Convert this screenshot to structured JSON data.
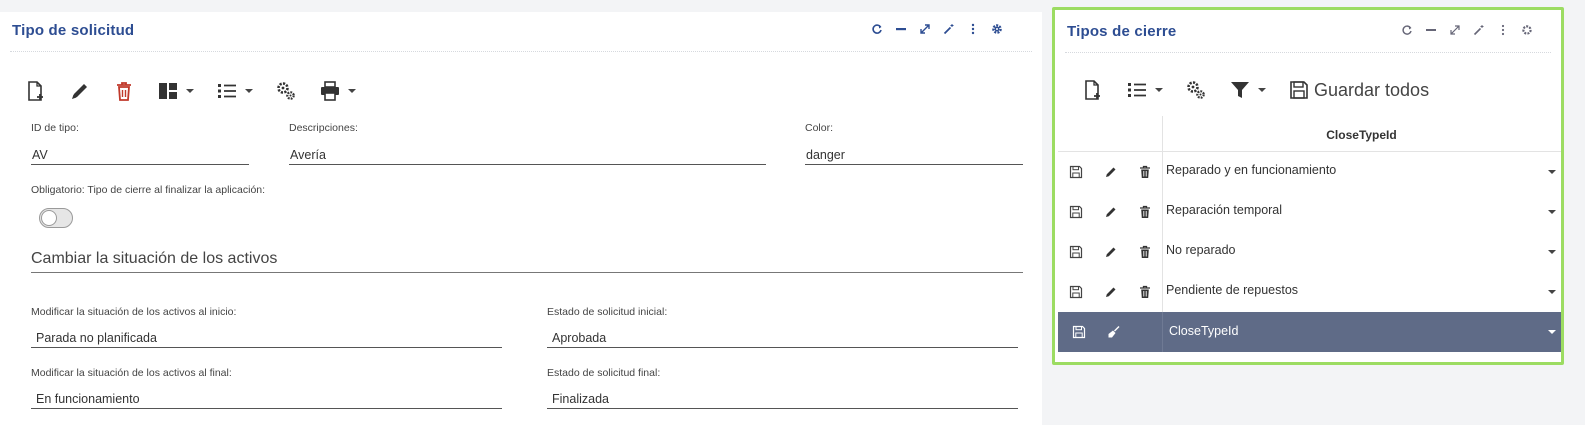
{
  "colors": {
    "title": "#2d4d92",
    "danger": "#c0392b",
    "highlight_border": "#9cdc62",
    "selected_row": "#5f6b87"
  },
  "left_panel": {
    "title": "Tipo de solicitud",
    "tools": [
      "refresh-icon",
      "minimize-icon",
      "expand-icon",
      "magic-wand-icon",
      "more-vertical-icon",
      "gear-icon"
    ],
    "toolbar": [
      "new-document-icon",
      "pencil-icon",
      "trash-icon",
      "layout-icon",
      "list-icon",
      "settings-cogs-icon",
      "printer-icon"
    ],
    "fields": {
      "type_id": {
        "label": "ID de tipo:",
        "value": "AV"
      },
      "descriptions": {
        "label": "Descripciones:",
        "value": "Avería"
      },
      "color": {
        "label": "Color:",
        "value": "danger"
      },
      "mandatory": {
        "label": "Obligatorio: Tipo de cierre al finalizar la aplicación:",
        "checked": false
      }
    },
    "section": {
      "title": "Cambiar la situación de los activos"
    },
    "asset_fields": {
      "modify_start": {
        "label": "Modificar la situación de los activos al inicio:",
        "value": "Parada no planificada"
      },
      "initial_state": {
        "label": "Estado de solicitud inicial:",
        "value": "Aprobada"
      },
      "modify_end": {
        "label": "Modificar la situación de los activos al final:",
        "value": "En funcionamiento"
      },
      "final_state": {
        "label": "Estado de solicitud final:",
        "value": "Finalizada"
      }
    }
  },
  "right_panel": {
    "title": "Tipos de cierre",
    "tools": [
      "refresh-icon",
      "minimize-icon",
      "expand-icon",
      "magic-wand-icon",
      "more-vertical-icon",
      "gear-icon"
    ],
    "toolbar": {
      "save_all_label": "Guardar todos"
    },
    "grid": {
      "column_header": "CloseTypeId",
      "rows": [
        {
          "value": "Reparado y en funcionamiento"
        },
        {
          "value": "Reparación temporal"
        },
        {
          "value": "No reparado"
        },
        {
          "value": "Pendiente de repuestos"
        }
      ],
      "new_row": {
        "value": "CloseTypeId"
      }
    }
  }
}
